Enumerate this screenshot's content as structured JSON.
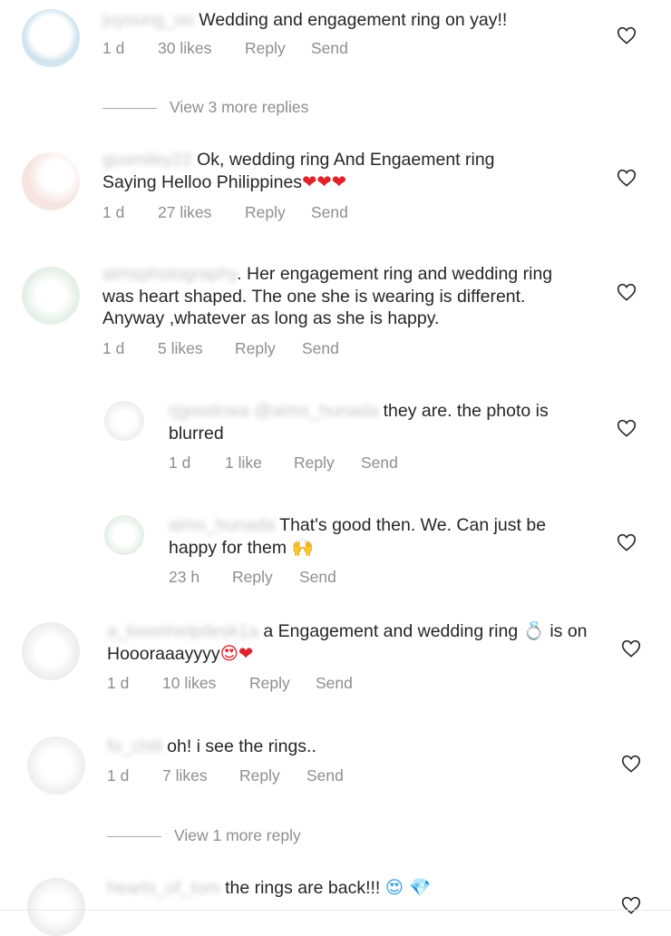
{
  "comments": [
    {
      "username": "juyoung_oo",
      "text": "Wedding and engagement ring on yay!!",
      "time": "1 d",
      "likes": "30 likes",
      "reply": "Reply",
      "send": "Send"
    },
    {
      "username": "gusmiley22",
      "text_line1": "Ok, wedding ring And Engaement ring",
      "text_line2": "Saying Helloo Philippines",
      "emoji": "❤❤❤",
      "time": "1 d",
      "likes": "27 likes",
      "reply": "Reply",
      "send": "Send"
    },
    {
      "username": "aimsphotography",
      "text_line1": ". Her engagement ring and wedding ring",
      "text_line2": "was heart shaped. The one she is wearing is different.",
      "text_line3": "Anyway ,whatever as long as she is happy.",
      "time": "1 d",
      "likes": "5 likes",
      "reply": "Reply",
      "send": "Send"
    },
    {
      "username": "rjgoodcwa @aims_hunada",
      "text_line1": "they are. the photo is",
      "text_line2": "blurred",
      "time": "1 d",
      "likes": "1 like",
      "reply": "Reply",
      "send": "Send"
    },
    {
      "username": "aims_hunada",
      "text_line1": "That's good then. We. Can just be",
      "text_line2": "happy for them",
      "emoji": "🙌",
      "time": "23 h",
      "likes": "",
      "reply": "Reply",
      "send": "Send"
    },
    {
      "username": "a_kwonhelpdesk1a",
      "text_line1": "a Engagement and wedding ring",
      "ring_emoji": "💍",
      "text_line1_end": "is on",
      "text_line2": "Hoooraaayyyy",
      "emoji": "😍❤",
      "time": "1 d",
      "likes": "10 likes",
      "reply": "Reply",
      "send": "Send"
    },
    {
      "username": "fo_chill",
      "text": "oh! i see the rings..",
      "time": "1 d",
      "likes": "7 likes",
      "reply": "Reply",
      "send": "Send"
    },
    {
      "username": "hearts_of_tom",
      "text": "the rings are back!!!",
      "emoji": "😍 💎"
    }
  ],
  "view_more": [
    "View 3 more replies",
    "View 1 more reply"
  ],
  "colors": {
    "text": "#262626",
    "secondary": "#8e8e8e",
    "heart_emoji": "#e0222b"
  }
}
